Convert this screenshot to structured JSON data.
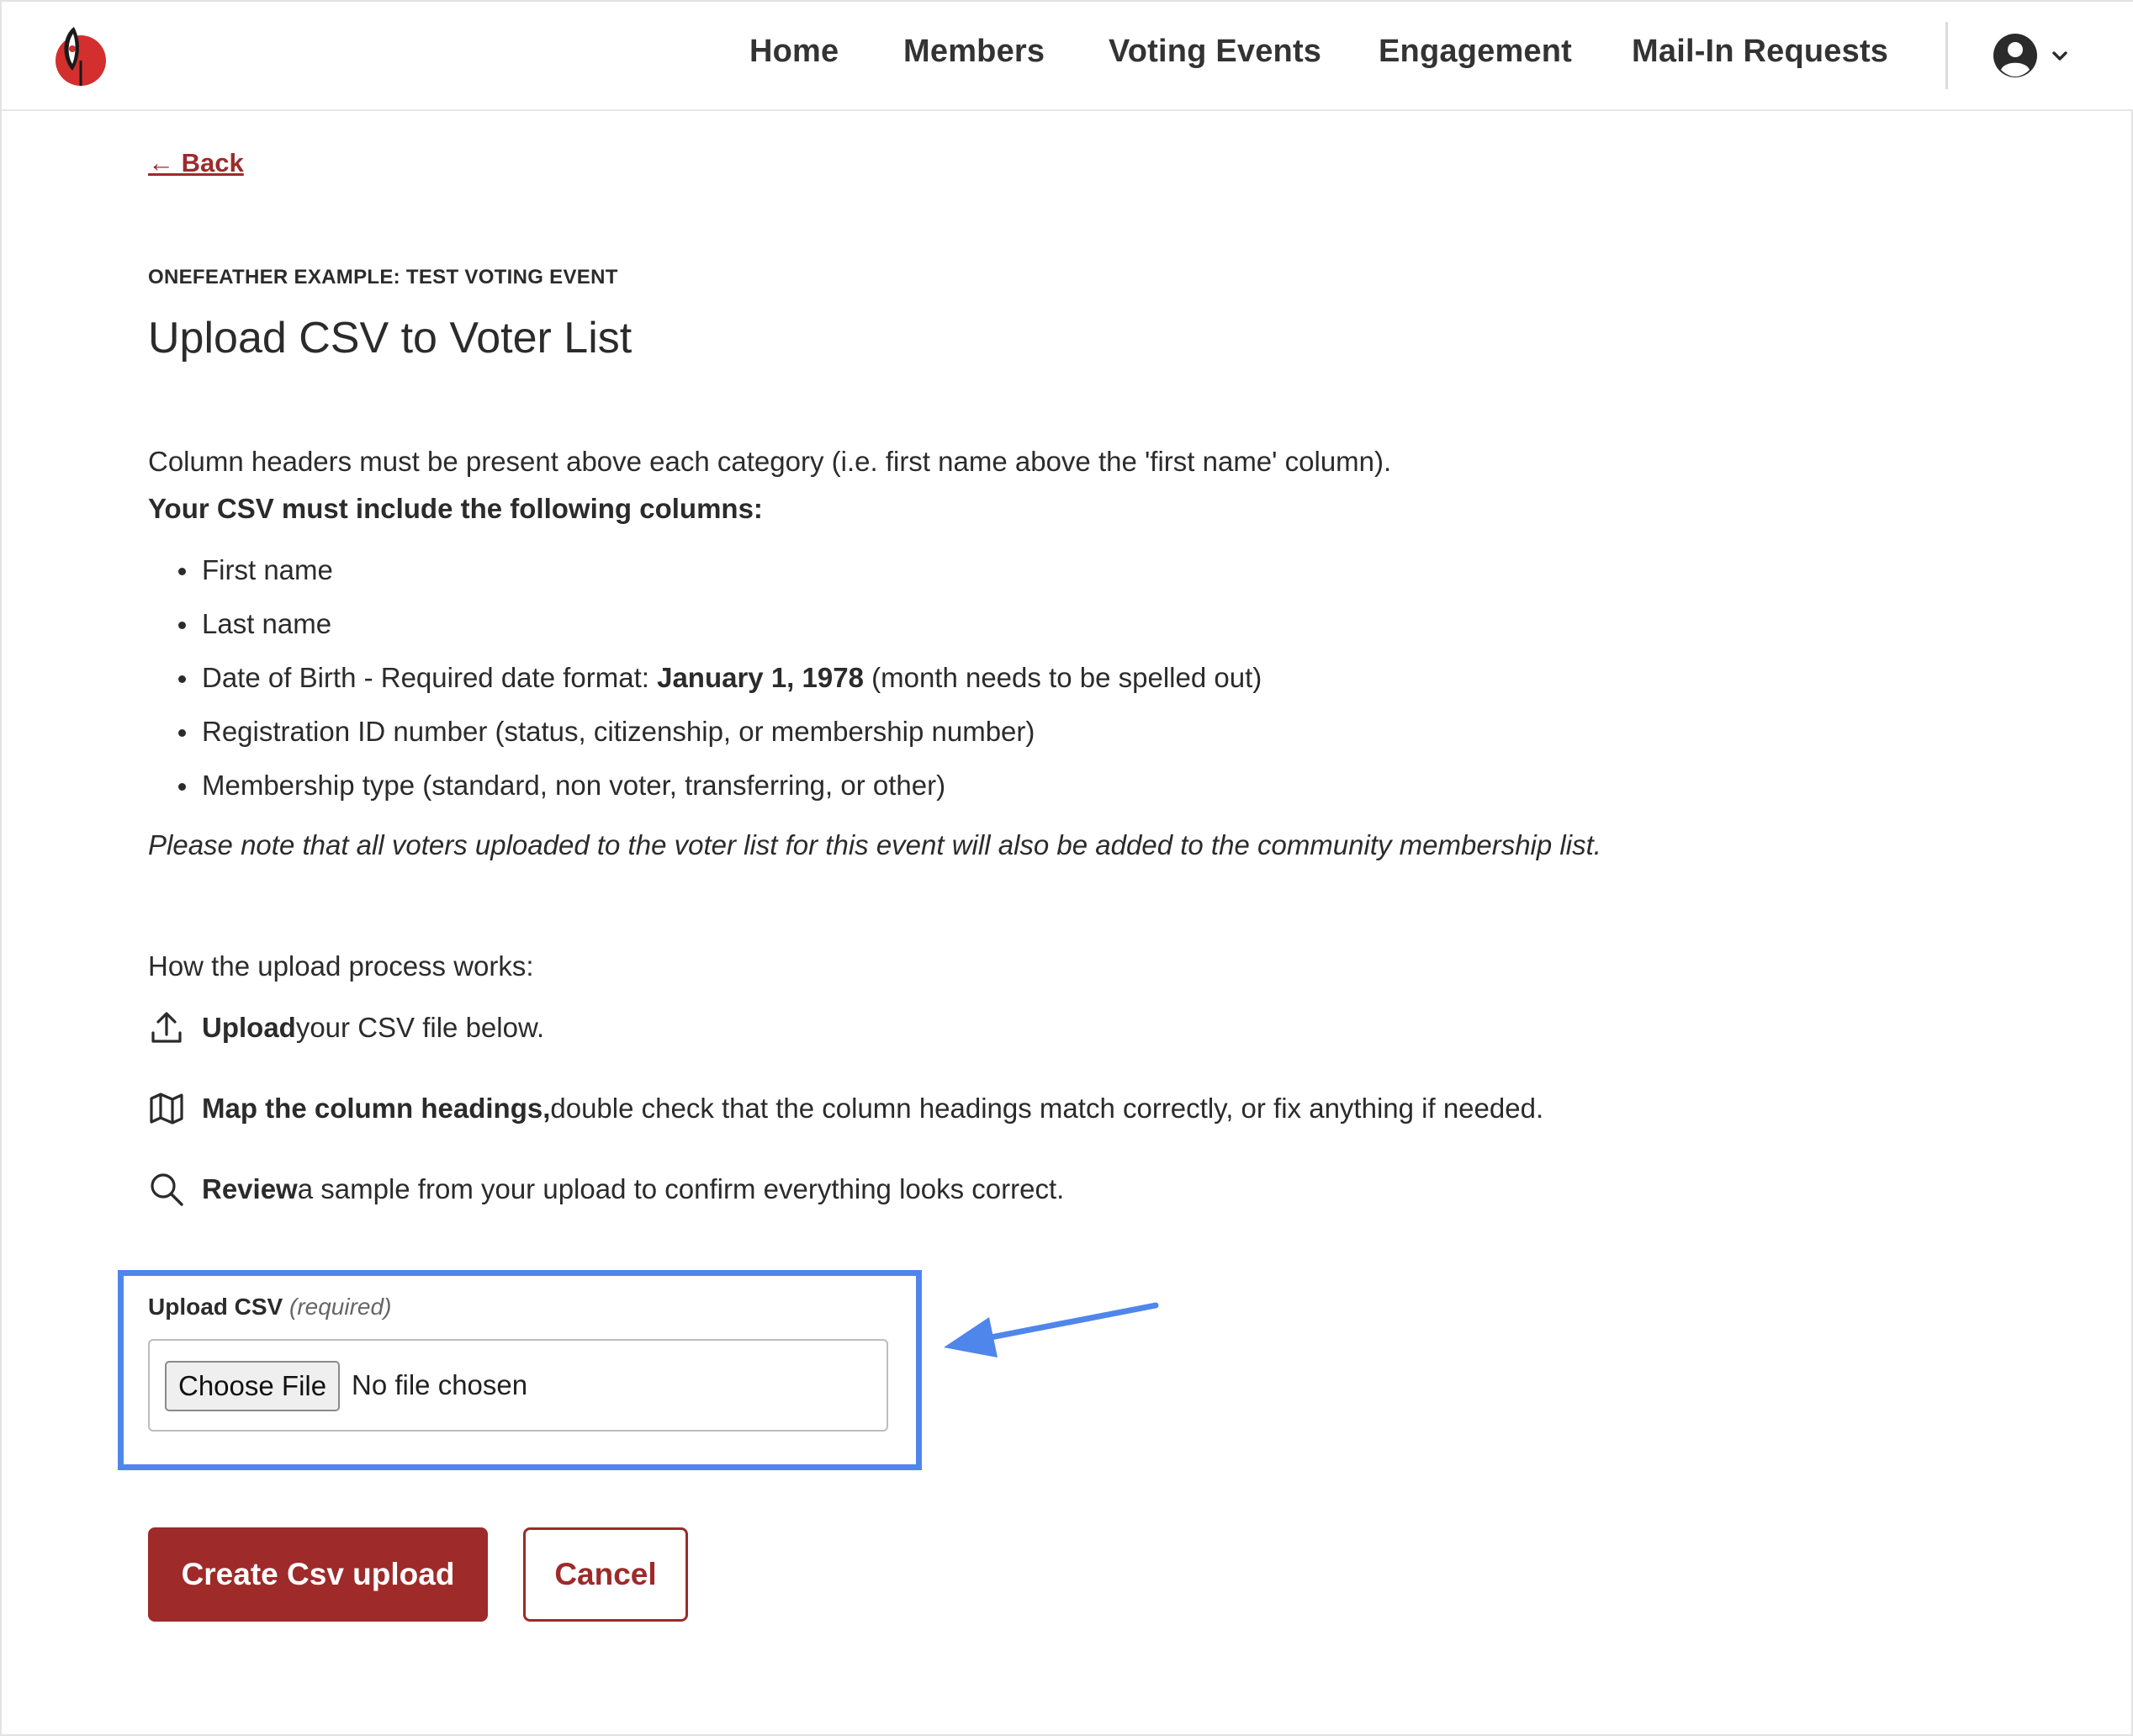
{
  "header": {
    "logo_icon": "feather-logo-icon",
    "nav": [
      {
        "label": "Home"
      },
      {
        "label": "Members"
      },
      {
        "label": "Voting Events"
      },
      {
        "label": "Engagement"
      },
      {
        "label": "Mail-In Requests"
      }
    ],
    "user_icon": "user-circle-icon",
    "chevron_icon": "chevron-down-icon"
  },
  "page": {
    "back_label": "← Back",
    "eyebrow": "ONEFEATHER EXAMPLE: TEST VOTING EVENT",
    "title": "Upload CSV to Voter List"
  },
  "instructions": {
    "intro": "Column headers must be present above each category (i.e. first name above the 'first name' column).",
    "columns_heading": "Your CSV must include the following columns:",
    "columns": {
      "first_name": "First name",
      "last_name": "Last name",
      "dob_prefix": "Date of Birth - Required date format: ",
      "dob_example": "January 1, 1978",
      "dob_suffix": " (month needs to be spelled out)",
      "registration": "Registration ID number (status, citizenship, or membership number)",
      "membership_type": "Membership type (standard, non voter, transferring, or other)"
    },
    "note": "Please note that all voters uploaded to the voter list for this event will also be added to the community membership list."
  },
  "process": {
    "heading": "How the upload process works:",
    "steps": [
      {
        "icon": "upload-icon",
        "bold": "Upload",
        "text": " your CSV file below."
      },
      {
        "icon": "map-icon",
        "bold": "Map the column headings,",
        "text": " double check that the column headings match correctly, or fix anything if needed."
      },
      {
        "icon": "search-icon",
        "bold": "Review",
        "text": " a sample from your upload to confirm everything looks correct."
      }
    ]
  },
  "upload": {
    "label": "Upload CSV",
    "required": "(required)",
    "choose_file": "Choose File",
    "no_file": "No file chosen",
    "highlight_color": "#4f86ec"
  },
  "actions": {
    "submit_label": "Create Csv upload",
    "cancel_label": "Cancel"
  },
  "colors": {
    "brand": "#9e2a2a",
    "text": "#2b2b2b",
    "annotation": "#4f86ec"
  }
}
